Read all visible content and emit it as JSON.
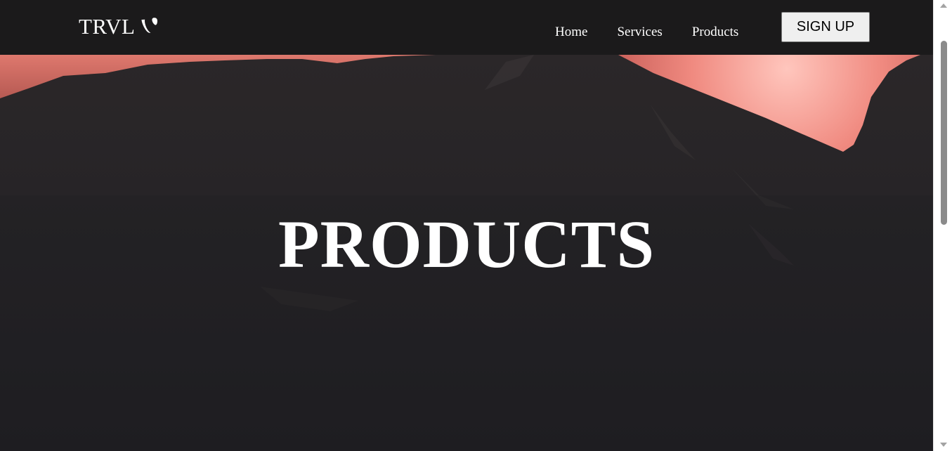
{
  "header": {
    "brand": "TRVL",
    "brand_icon": "typo3-logo-icon",
    "nav": [
      {
        "label": "Home"
      },
      {
        "label": "Services"
      },
      {
        "label": "Products"
      }
    ],
    "signup_label": "SIGN UP"
  },
  "hero": {
    "title": "PRODUCTS",
    "background": "mountain-sunset-photo"
  },
  "colors": {
    "navbar_bg": "#1b1a1b",
    "hero_dark": "#232124",
    "sky_glow": "#e8766f"
  }
}
